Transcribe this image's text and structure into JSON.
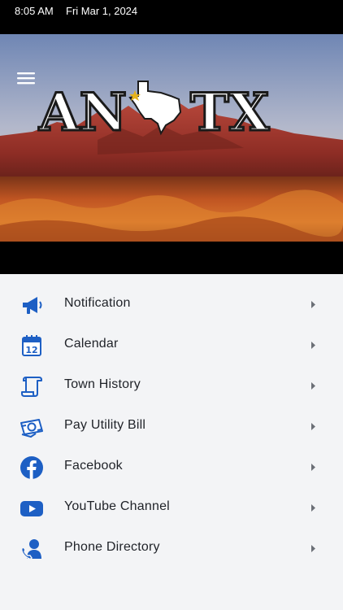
{
  "status_bar": {
    "time": "8:05 AM",
    "date": "Fri Mar 1, 2024"
  },
  "banner": {
    "text_left": "AN",
    "text_right": "TX",
    "menu_icon": "hamburger-icon",
    "state_icon": "texas-outline-icon"
  },
  "menu": {
    "items": [
      {
        "label": "Notification",
        "icon": "megaphone-icon"
      },
      {
        "label": "Calendar",
        "icon": "calendar-icon"
      },
      {
        "label": "Town History",
        "icon": "scroll-icon"
      },
      {
        "label": "Pay Utility Bill",
        "icon": "bill-payment-icon"
      },
      {
        "label": "Facebook",
        "icon": "facebook-icon"
      },
      {
        "label": "YouTube Channel",
        "icon": "youtube-icon"
      },
      {
        "label": "Phone Directory",
        "icon": "phone-contact-icon"
      }
    ]
  },
  "colors": {
    "accent": "#1d5fc4",
    "status_bar": "#000000",
    "background": "#f3f4f6",
    "text": "#1f2228",
    "chevron": "#6b6f76"
  }
}
